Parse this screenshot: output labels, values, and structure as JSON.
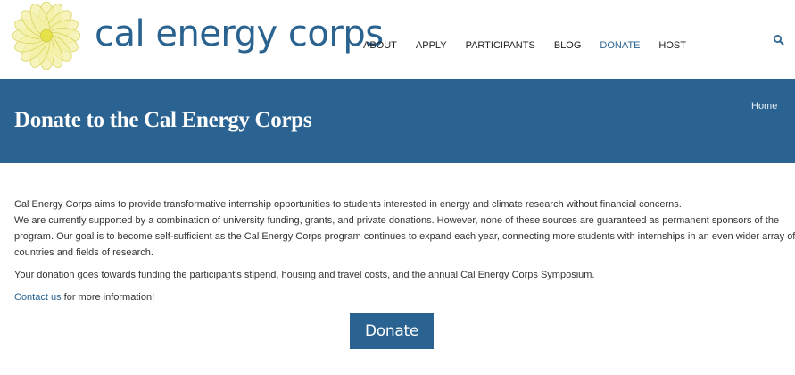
{
  "brand": {
    "logo_icon": "sunflower-mandala-icon",
    "name": "cal energy corps",
    "colors": {
      "primary": "#2a6391",
      "logo_yellow": "#e6e24a"
    }
  },
  "nav": {
    "items": [
      {
        "label": "ABOUT",
        "active": false
      },
      {
        "label": "APPLY",
        "active": false
      },
      {
        "label": "PARTICIPANTS",
        "active": false
      },
      {
        "label": "BLOG",
        "active": false
      },
      {
        "label": "DONATE",
        "active": true
      },
      {
        "label": "HOST",
        "active": false
      }
    ],
    "search_icon": "search-icon"
  },
  "banner": {
    "title": "Donate to the Cal Energy Corps",
    "breadcrumb": "Home"
  },
  "content": {
    "para1": {
      "line1": "Cal Energy Corps aims to provide transformative internship opportunities to students interested in energy and climate research without financial concerns.",
      "line2": "We are currently supported by a combination of university funding, grants, and private donations. However, none of these sources are guaranteed as permanent sponsors of the",
      "line3": "program. Our goal is to become self-sufficient as the Cal Energy Corps program continues to expand each year, connecting more students with internships in an even wider array of",
      "line4": "countries and fields of research."
    },
    "para2": "Your donation goes towards funding the participant's stipend, housing and travel costs, and the annual Cal Energy Corps Symposium.",
    "contact_link": "Contact us",
    "contact_rest": " for more information!"
  },
  "donate_button": {
    "label": "Donate"
  }
}
